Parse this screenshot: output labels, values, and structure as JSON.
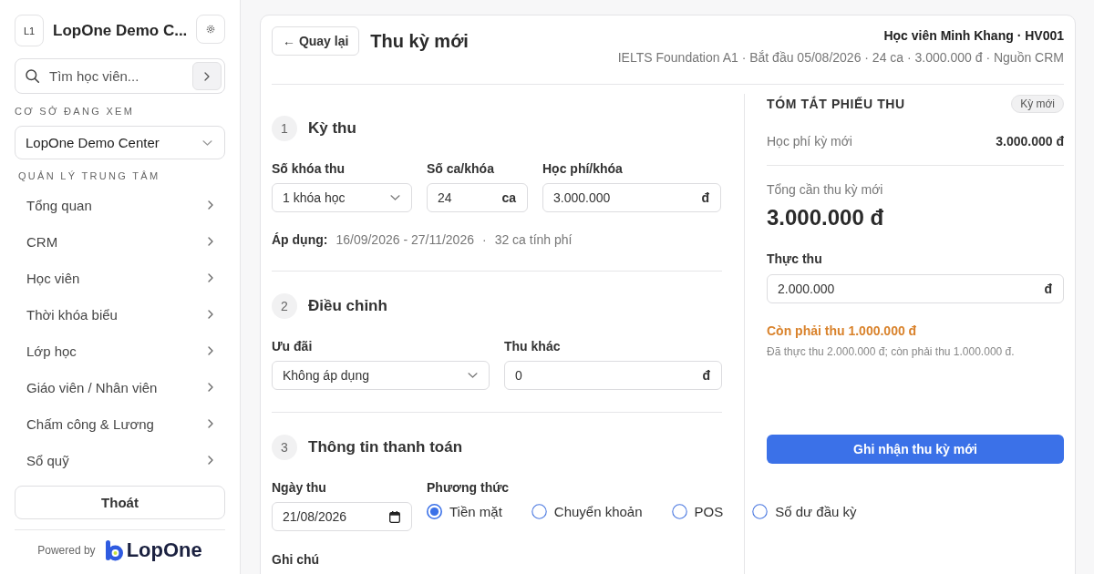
{
  "sidebar": {
    "logo_badge": "L1",
    "title": "LopOne Demo C...",
    "search": {
      "placeholder": "Tìm học viên..."
    },
    "branch": {
      "label": "CƠ SỞ ĐANG XEM",
      "value": "LopOne Demo Center"
    },
    "nav": {
      "heading": "QUẢN LÝ TRUNG TÂM",
      "items": [
        {
          "label": "Tổng quan"
        },
        {
          "label": "CRM"
        },
        {
          "label": "Học viên"
        },
        {
          "label": "Thời khóa biểu"
        },
        {
          "label": "Lớp học"
        },
        {
          "label": "Giáo viên / Nhân viên"
        },
        {
          "label": "Chấm công & Lương"
        },
        {
          "label": "Sổ quỹ"
        }
      ]
    },
    "logout_button": "Thoát",
    "footer": {
      "powered_by": "Powered by",
      "brand": "LopOne"
    }
  },
  "header": {
    "back_button": "← Quay lại",
    "title": "Thu kỳ mới",
    "student": "Học viên Minh Khang · HV001",
    "details": "IELTS Foundation A1 · Bắt đầu 05/08/2026 · 24 ca · 3.000.000 đ · Nguồn CRM"
  },
  "sections": [
    {
      "number": "1",
      "title": "Kỳ thu",
      "fields": [
        {
          "kind": "select",
          "label": "Số khóa thu",
          "value": "1 khóa học"
        },
        {
          "kind": "number",
          "label": "Số ca/khóa",
          "value": "24",
          "unit": "ca"
        },
        {
          "kind": "number",
          "label": "Học phí/khóa",
          "value": "3.000.000",
          "unit": "đ"
        }
      ],
      "applies": {
        "label": "Áp dụng:",
        "range": "16/09/2026 - 27/11/2026",
        "separator": "·",
        "sessions": "32 ca tính phí"
      }
    },
    {
      "number": "2",
      "title": "Điều chỉnh",
      "fields": [
        {
          "kind": "select",
          "label": "Ưu đãi",
          "value": "Không áp dụng"
        },
        {
          "kind": "number",
          "label": "Thu khác",
          "value": "0",
          "unit": "đ"
        }
      ]
    },
    {
      "number": "3",
      "title": "Thông tin thanh toán",
      "fields": [
        {
          "kind": "date",
          "label": "Ngày thu",
          "value": "21/08/2026"
        },
        {
          "kind": "radio",
          "label": "Phương thức",
          "options": [
            {
              "label": "Tiền mặt",
              "selected": true
            },
            {
              "label": "Chuyển khoản",
              "selected": false
            },
            {
              "label": "POS",
              "selected": false
            },
            {
              "label": "Số dư đầu kỳ",
              "selected": false
            }
          ]
        }
      ],
      "note_label": "Ghi chú"
    }
  ],
  "summary": {
    "title": "TÓM TẮT PHIẾU THU",
    "badge": "Kỳ mới",
    "fee_label": "Học phí kỳ mới",
    "fee_value": "3.000.000 đ",
    "total_label": "Tổng cần thu kỳ mới",
    "total_value": "3.000.000 đ",
    "paid_label": "Thực thu",
    "paid_value": "2.000.000",
    "paid_unit": "đ",
    "remaining": "Còn phải thu 1.000.000 đ",
    "note": "Đã thực thu 2.000.000 đ; còn phải thu 1.000.000 đ.",
    "submit_button": "Ghi nhận thu kỳ mới"
  }
}
